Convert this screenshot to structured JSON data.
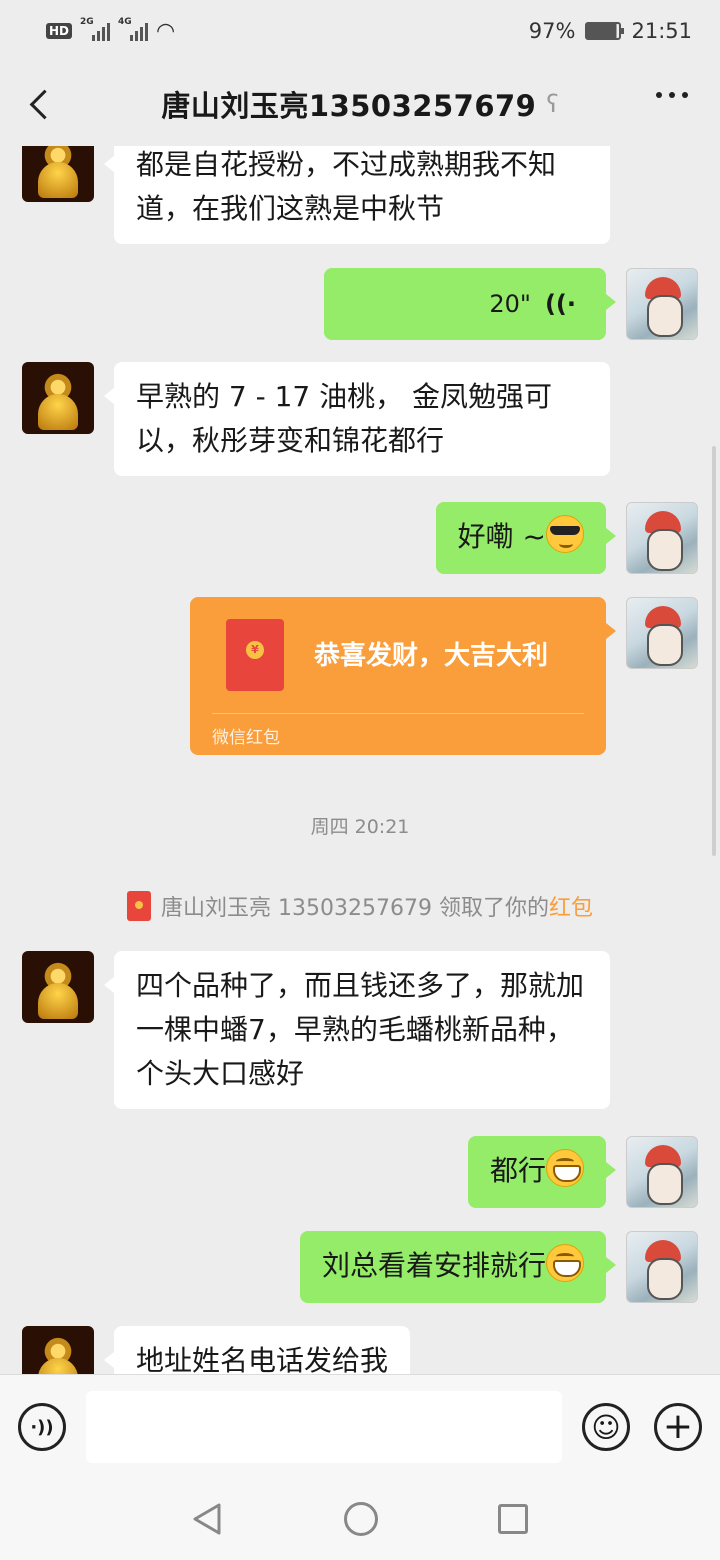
{
  "status_bar": {
    "hd": "HD",
    "net1": "2G",
    "net2": "4G",
    "battery": "97%",
    "time": "21:51"
  },
  "header": {
    "title": "唐山刘玉亮13503257679",
    "ear_icon": "ear-icon",
    "more_icon": "more-dots-icon"
  },
  "messages": {
    "m1": {
      "text": "都是自花授粉，不过成熟期我不知道，在我们这熟是中秋节"
    },
    "m2": {
      "duration": "20\""
    },
    "m3": {
      "text": "早熟的 7 - 17 油桃， 金凤勉强可以，秋彤芽变和锦花都行"
    },
    "m4": {
      "text": "好嘞 ~"
    },
    "m5": {
      "title": "恭喜发财，大吉大利",
      "footer": "微信红包"
    },
    "time": "周四 20:21",
    "system": {
      "prefix": "唐山刘玉亮 13503257679 领取了你的",
      "highlight": "红包"
    },
    "m6": {
      "text": "四个品种了，而且钱还多了，那就加一棵中蟠7，早熟的毛蟠桃新品种，个头大口感好"
    },
    "m7": {
      "text": "都行"
    },
    "m8": {
      "text": "刘总看着安排就行"
    },
    "m9": {
      "text": "地址姓名电话发给我"
    }
  },
  "input": {
    "placeholder": ""
  },
  "colors": {
    "bubble_out": "#95ec69",
    "bubble_in": "#ffffff",
    "red_packet": "#fa9d3b",
    "background": "#ededed"
  }
}
